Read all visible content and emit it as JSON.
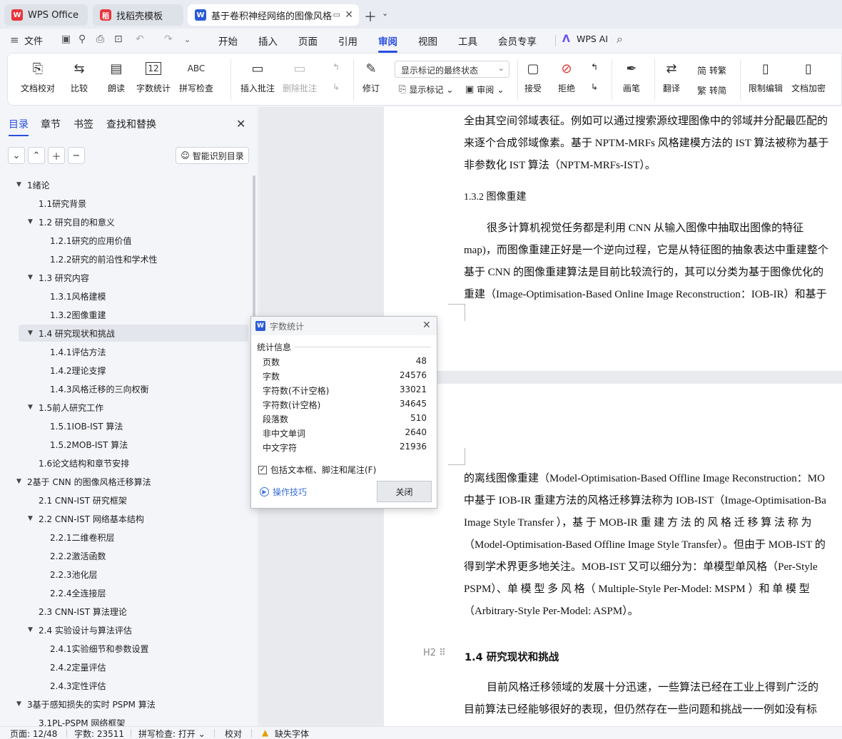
{
  "tabs": [
    {
      "label": "WPS Office"
    },
    {
      "label": "找稻壳模板"
    },
    {
      "label": "基于卷积神经网络的图像风格迁"
    }
  ],
  "menubar": {
    "file": "文件",
    "items": [
      "开始",
      "插入",
      "页面",
      "引用",
      "审阅",
      "视图",
      "工具",
      "会员专享"
    ],
    "wps_ai": "WPS AI"
  },
  "ribbon": {
    "doc_check": "文档校对",
    "compare": "比较",
    "read_aloud": "朗读",
    "word_count": "字数统计",
    "spell_check": "拼写检查",
    "insert_comment": "插入批注",
    "delete_comment": "删除批注",
    "track_changes": "修订",
    "markup_select": "显示标记的最终状态",
    "show_markup": "显示标记",
    "review": "审阅",
    "accept": "接受",
    "reject": "拒绝",
    "pen": "画笔",
    "translate": "翻译",
    "to_traditional": "转繁",
    "to_simplified": "转简",
    "restrict_edit": "限制编辑",
    "doc_encrypt": "文档加密"
  },
  "nav": {
    "tabs": [
      "目录",
      "章节",
      "书签",
      "查找和替换"
    ],
    "smart_toc": "智能识别目录",
    "toc": [
      "1绪论",
      "1.1研究背景",
      "1.2  研究目的和意义",
      "1.2.1研究的应用价值",
      "1.2.2研究的前沿性和学术性",
      "1.3  研究内容",
      "1.3.1风格建模",
      "1.3.2图像重建",
      "1.4  研究现状和挑战",
      "1.4.1评估方法",
      "1.4.2理论支撑",
      "1.4.3风格迁移的三向权衡",
      "1.5前人研究工作",
      "1.5.1IOB-IST 算法",
      "1.5.2MOB-IST 算法",
      "1.6论文结构和章节安排",
      "2基于 CNN 的图像风格迁移算法",
      "2.1  CNN-IST  研究框架",
      "2.2  CNN-IST  网络基本结构",
      "2.2.1二维卷积层",
      "2.2.2激活函数",
      "2.2.3池化层",
      "2.2.4全连接层",
      "2.3  CNN-IST  算法理论",
      "2.4  实验设计与算法评估",
      "2.4.1实验细节和参数设置",
      "2.4.2定量评估",
      "2.4.3定性评估",
      "3基于感知损失的实时 PSPM 算法",
      "3.1PL-PSPM  网络框架"
    ]
  },
  "document": {
    "page1_lines": [
      "全由其空间邻域表征。例如可以通过搜索源纹理图像中的邻域并分配最匹配的",
      "来逐个合成邻域像素。基于 NPTM-MRFs 风格建模方法的 IST 算法被称为基于",
      "非参数化 IST 算法（NPTM-MRFs-IST）。"
    ],
    "section_132": "1.3.2      图像重建",
    "page1_para": [
      "很多计算机视觉任务都是利用 CNN 从输入图像中抽取出图像的特征",
      "map)，而图像重建正好是一个逆向过程，它是从特征图的抽象表达中重建整个",
      "基于 CNN 的图像重建算法是目前比较流行的，其可以分类为基于图像优化的",
      "重建（Image-Optimisation-Based Online Image Reconstruction：IOB-IR）和基于"
    ],
    "page2_lines": [
      "的离线图像重建（Model-Optimisation-Based Offline Image Reconstruction：MO",
      "中基于 IOB-IR 重建方法的风格迁移算法称为 IOB-IST（Image-Optimisation-Ba",
      "Image  Style  Transfer ），基 于  MOB-IR  重 建 方 法 的 风 格 迁 移 算 法 称 为",
      "（Model-Optimisation-Based Offline Image Style Transfer）。但由于 MOB-IST 的",
      "得到学术界更多地关注。MOB-IST 又可以细分为：单模型单风格（Per-Style",
      "PSPM）、单 模 型 多 风 格（ Multiple-Style  Per-Model:  MSPM ）和 单 模 型",
      "（Arbitrary-Style Per-Model: ASPM）。"
    ],
    "h2_label": "H2",
    "heading_14": "1.4  研究现状和挑战",
    "page2_para": [
      "目前风格迁移领域的发展十分迅速，一些算法已经在工业上得到广泛的",
      "目前算法已经能够很好的表现，但仍然存在一些问题和挑战一一例如没有标"
    ]
  },
  "dialog": {
    "title": "字数统计",
    "section": "统计信息",
    "stats": [
      {
        "label": "页数",
        "value": "48"
      },
      {
        "label": "字数",
        "value": "24576"
      },
      {
        "label": "字符数(不计空格)",
        "value": "33021"
      },
      {
        "label": "字符数(计空格)",
        "value": "34645"
      },
      {
        "label": "段落数",
        "value": "510"
      },
      {
        "label": "非中文单词",
        "value": "2640"
      },
      {
        "label": "中文字符",
        "value": "21936"
      }
    ],
    "include_label": "包括文本框、脚注和尾注(F)",
    "include_checked": true,
    "tips": "操作技巧",
    "close": "关闭"
  },
  "statusbar": {
    "page": "页面: 12/48",
    "words": "字数: 23511",
    "spell": "拼写检查: 打开",
    "proof": "校对",
    "missing_font": "缺失字体"
  },
  "colors": {
    "accent": "#2a4fe0",
    "wps_red": "#e8353b",
    "doc_blue": "#2a5bd7"
  }
}
